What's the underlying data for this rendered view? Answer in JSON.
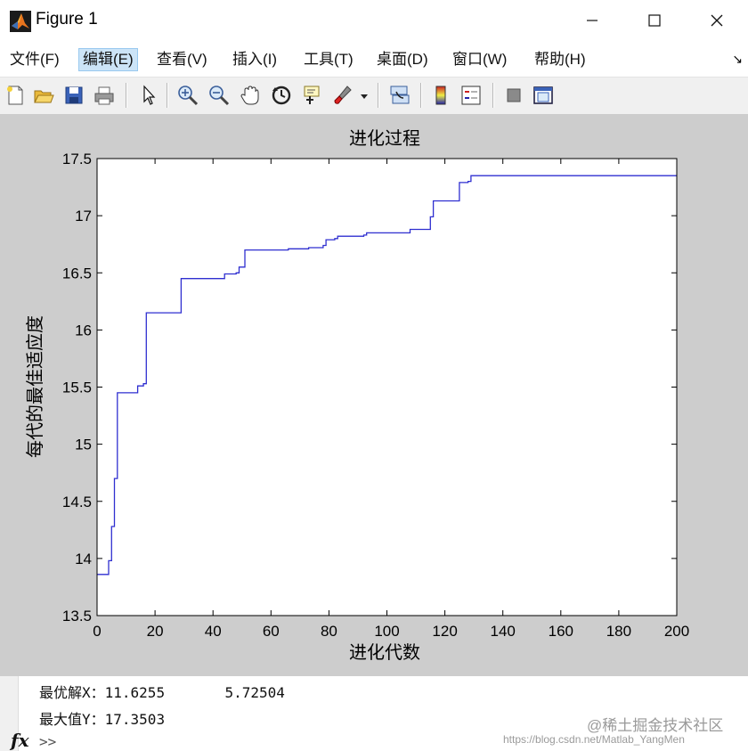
{
  "window": {
    "title": "Figure 1"
  },
  "menu": {
    "items": [
      "文件(F)",
      "编辑(E)",
      "查看(V)",
      "插入(I)",
      "工具(T)",
      "桌面(D)",
      "窗口(W)",
      "帮助(H)"
    ]
  },
  "toolbar": {
    "icons": [
      "new-figure-icon",
      "open-file-icon",
      "save-icon",
      "print-icon",
      "pointer-icon",
      "zoom-in-icon",
      "zoom-out-icon",
      "pan-hand-icon",
      "rotate-3d-icon",
      "data-cursor-icon",
      "brush-icon",
      "link-plot-icon",
      "colorbar-icon",
      "legend-icon",
      "hide-plot-tools-icon",
      "show-plot-tools-icon"
    ]
  },
  "colors": {
    "line": "#2f2fd0",
    "figure_bg": "#cdcdcd",
    "highlight": "#cce4f7"
  },
  "chart_data": {
    "type": "line",
    "title": "进化过程",
    "xlabel": "进化代数",
    "ylabel": "每代的最佳适应度",
    "xlim": [
      0,
      200
    ],
    "ylim": [
      13.5,
      17.5
    ],
    "xticks": [
      "0",
      "20",
      "40",
      "60",
      "80",
      "100",
      "120",
      "140",
      "160",
      "180",
      "200"
    ],
    "yticks": [
      "13.5",
      "14",
      "14.5",
      "15",
      "15.5",
      "16",
      "16.5",
      "17",
      "17.5"
    ],
    "grid": false,
    "series": [
      {
        "x": [
          0,
          3,
          4,
          5,
          6,
          7,
          13,
          14,
          16,
          17,
          28,
          29,
          43,
          44,
          48,
          49,
          51,
          52,
          60,
          66,
          73,
          78,
          79,
          82,
          83,
          92,
          93,
          107,
          108,
          114,
          115,
          116,
          124,
          125,
          128,
          129,
          200
        ],
        "y": [
          13.86,
          13.86,
          13.98,
          14.28,
          14.7,
          15.45,
          15.45,
          15.51,
          15.53,
          16.15,
          16.15,
          16.45,
          16.45,
          16.49,
          16.5,
          16.55,
          16.7,
          16.7,
          16.7,
          16.71,
          16.72,
          16.74,
          16.79,
          16.8,
          16.82,
          16.83,
          16.85,
          16.85,
          16.88,
          16.88,
          16.99,
          17.13,
          17.13,
          17.29,
          17.3,
          17.35,
          17.35
        ]
      }
    ]
  },
  "command_window": {
    "line1_label": "最优解X：",
    "line1_values": "11.6255       5.72504",
    "line2_label": "最大值Y：",
    "line2_value": "17.3503",
    "fx_label": "fx",
    "prompt": ">>"
  },
  "watermark": {
    "community": "@稀土掘金技术社区",
    "url": "https://blog.csdn.net/Matlab_YangMen"
  }
}
